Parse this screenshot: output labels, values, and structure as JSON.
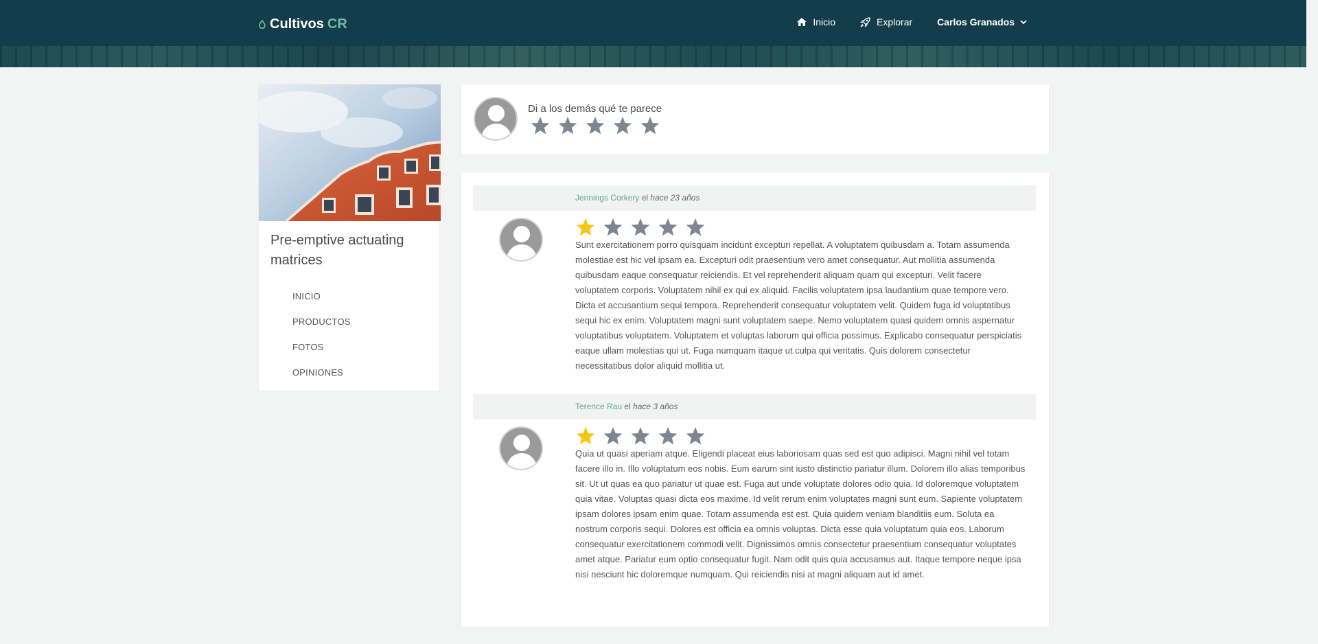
{
  "header": {
    "brand_main": "Cultivos",
    "brand_accent": "CR",
    "nav": {
      "home_label": "Inicio",
      "explore_label": "Explorar",
      "user_name": "Carlos Granados"
    }
  },
  "sidebar": {
    "title": "Pre-emptive actuating matrices",
    "menu": [
      "INICIO",
      "PRODUCTOS",
      "FOTOS",
      "OPINIONES"
    ]
  },
  "rate": {
    "prompt": "Di a los demás qué te parece",
    "stars_max": 5,
    "rating": 0
  },
  "reviews": [
    {
      "author": "Jennings Corkery",
      "connector": "el",
      "when": "hace 23 años",
      "rating": 1,
      "stars_max": 5,
      "text": "Sunt exercitationem porro quisquam incidunt excepturi repellat. A voluptatem quibusdam a. Totam assumenda molestiae est hic vel ipsam ea. Excepturi odit praesentium vero amet consequatur. Aut mollitia assumenda quibusdam eaque consequatur reiciendis. Et vel reprehenderit aliquam quam qui excepturi. Velit facere voluptatem corporis. Voluptatem nihil ex qui ex aliquid. Facilis voluptatem ipsa laudantium quae tempore vero. Dicta et accusantium sequi tempora. Reprehenderit consequatur voluptatem velit. Quidem fuga id voluptatibus sequi hic ex enim. Voluptatem magni sunt voluptatem saepe. Nemo voluptatem quasi quidem omnis aspernatur voluptatibus voluptatem. Voluptatem et voluptas laborum qui officia possimus. Explicabo consequatur perspiciatis eaque ullam molestias qui ut. Fuga numquam itaque ut culpa qui veritatis. Quis dolorem consectetur necessitatibus dolor aliquid mollitia ut."
    },
    {
      "author": "Terence Rau",
      "connector": "el",
      "when": "hace 3 años",
      "rating": 1,
      "stars_max": 5,
      "text": "Quia ut quasi aperiam atque. Eligendi placeat eius laboriosam quas sed est quo adipisci. Magni nihil vel totam facere illo in. Illo voluptatum eos nobis. Eum earum sint iusto distinctio pariatur illum. Dolorem illo alias temporibus sit. Ut ut quas ea quo pariatur ut quae est. Fuga aut unde voluptate dolores odio quia. Id doloremque voluptatem quia vitae. Voluptas quasi dicta eos maxime. Id velit rerum enim voluptates magni sunt eum. Sapiente voluptatem ipsam dolores ipsam enim quae. Totam assumenda est est. Quia quidem veniam blanditiis eum. Soluta ea nostrum corporis sequi. Dolores est officia ea omnis voluptas. Dicta esse quia voluptatum quia eos. Laborum consequatur exercitationem commodi velit. Dignissimos omnis consectetur praesentium consequatur voluptates amet atque. Pariatur eum optio consequatur fugit. Nam odit quis quia accusamus aut. Itaque tempore neque ipsa nisi nesciunt hic doloremque numquam. Qui reiciendis nisi at magni aliquam aut id amet."
    }
  ],
  "colors": {
    "topbar": "#143d4b",
    "accent": "#6fbf9f",
    "star_filled": "#f5c518",
    "star_empty": "#7d8791"
  }
}
